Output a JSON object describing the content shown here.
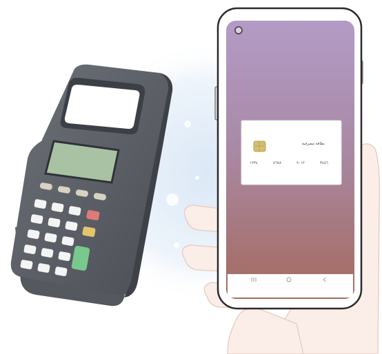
{
  "illustration": {
    "subject": "Mobile NFC payment at a card terminal",
    "colors": {
      "terminal_body": "#5b5f66",
      "terminal_screen": "#a9c2a4",
      "phone_screen_top": "#b49ac4",
      "phone_screen_bottom": "#a36a5f",
      "card_chip": "#d4bf72",
      "green_key": "#79c98e",
      "red_key": "#e07a7a",
      "yellow_key": "#e2c56e"
    }
  },
  "phone": {
    "screen_card": {
      "card_name": "بطاقة مصرفية",
      "number_groups": [
        "١٢٣٤",
        "٥٦٧٨",
        "٩٠١٢",
        "٣٤٥٦"
      ]
    },
    "nav_bar": {
      "recent_icon": "recent-apps-icon",
      "home_icon": "home-icon",
      "back_icon": "back-icon"
    }
  }
}
